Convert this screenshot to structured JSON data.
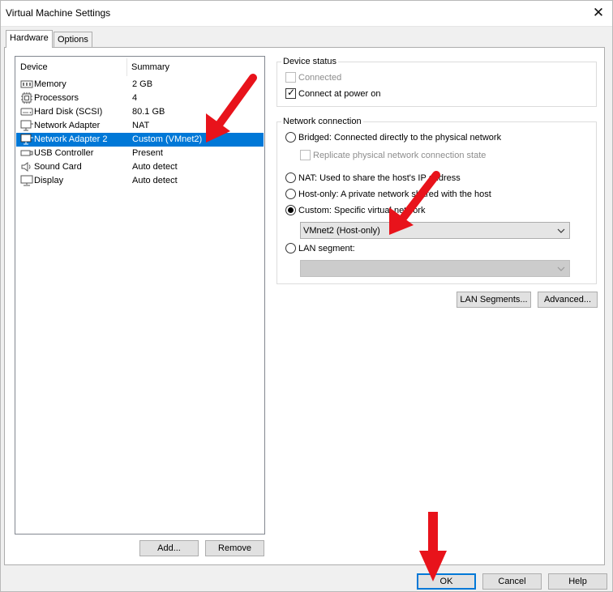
{
  "window": {
    "title": "Virtual Machine Settings"
  },
  "tabs": [
    {
      "label": "Hardware"
    },
    {
      "label": "Options"
    }
  ],
  "device_list": {
    "columns": {
      "device": "Device",
      "summary": "Summary"
    },
    "rows": [
      {
        "name": "Memory",
        "summary": "2 GB",
        "icon": "memory-icon"
      },
      {
        "name": "Processors",
        "summary": "4",
        "icon": "processor-icon"
      },
      {
        "name": "Hard Disk (SCSI)",
        "summary": "80.1 GB",
        "icon": "hard-disk-icon"
      },
      {
        "name": "Network Adapter",
        "summary": "NAT",
        "icon": "network-adapter-icon"
      },
      {
        "name": "Network Adapter 2",
        "summary": "Custom (VMnet2)",
        "icon": "network-adapter-icon",
        "selected": true
      },
      {
        "name": "USB Controller",
        "summary": "Present",
        "icon": "usb-icon"
      },
      {
        "name": "Sound Card",
        "summary": "Auto detect",
        "icon": "speaker-icon"
      },
      {
        "name": "Display",
        "summary": "Auto detect",
        "icon": "monitor-icon"
      }
    ],
    "add_label": "Add...",
    "remove_label": "Remove"
  },
  "device_status": {
    "title": "Device status",
    "connected_label": "Connected",
    "connected_checked": false,
    "connect_power_on_label": "Connect at power on",
    "connect_power_on_checked": true
  },
  "network_connection": {
    "title": "Network connection",
    "bridged_label": "Bridged: Connected directly to the physical network",
    "replicate_label": "Replicate physical network connection state",
    "nat_label": "NAT: Used to share the host's IP address",
    "hostonly_label": "Host-only: A private network shared with the host",
    "custom_label": "Custom: Specific virtual network",
    "custom_selected": true,
    "custom_value": "VMnet2 (Host-only)",
    "lan_segment_label": "LAN segment:",
    "lan_segment_value": ""
  },
  "buttons": {
    "lan_segments": "LAN Segments...",
    "advanced": "Advanced...",
    "ok": "OK",
    "cancel": "Cancel",
    "help": "Help"
  },
  "colors": {
    "selection": "#0078d7",
    "annotation_arrow": "#e8131b"
  }
}
